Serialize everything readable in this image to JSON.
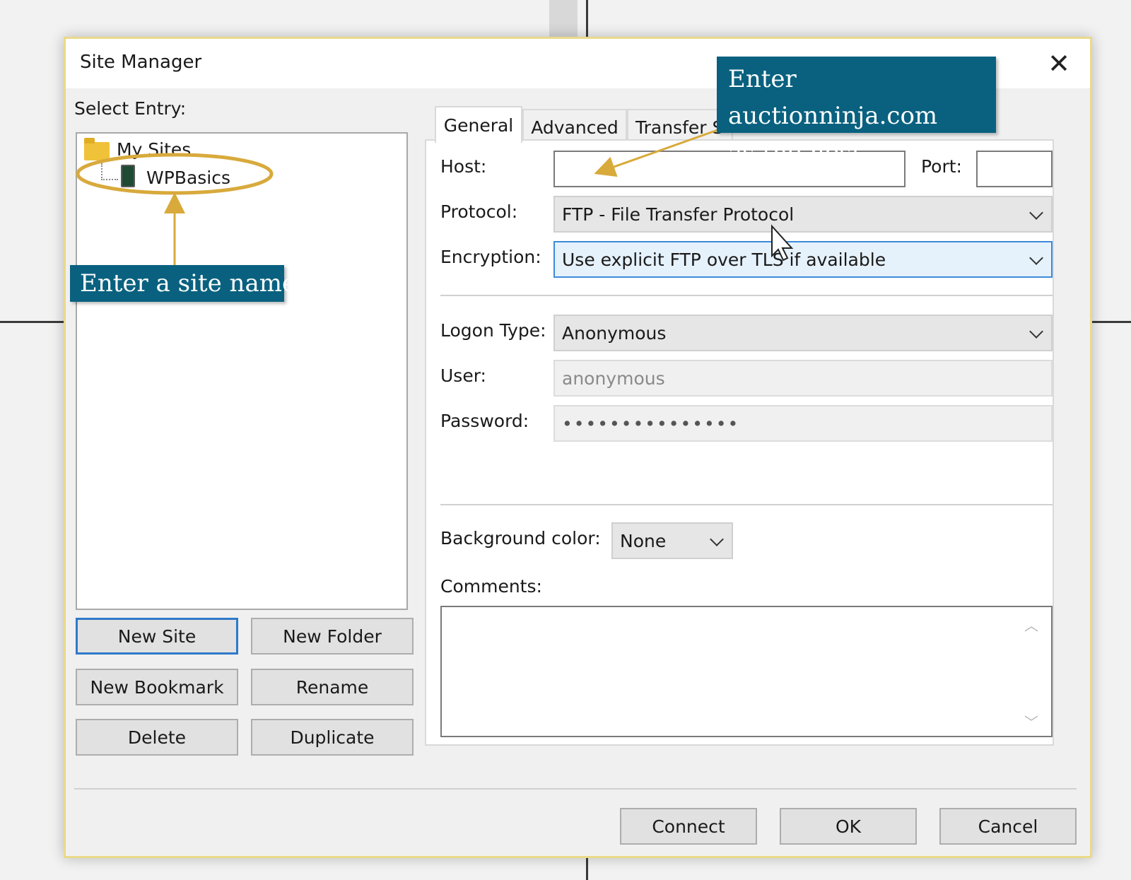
{
  "dialog": {
    "title": "Site Manager",
    "select_entry_label": "Select Entry:",
    "close_glyph": "✕"
  },
  "tree": {
    "root_label": "My Sites",
    "site_label": "WPBasics"
  },
  "left_buttons": {
    "new_site": "New Site",
    "new_folder": "New Folder",
    "new_bookmark": "New Bookmark",
    "rename": "Rename",
    "delete": "Delete",
    "duplicate": "Duplicate"
  },
  "tabs": [
    "General",
    "Advanced",
    "Transfer S"
  ],
  "general": {
    "host_label": "Host:",
    "host_value": "",
    "port_label": "Port:",
    "port_value": "",
    "protocol_label": "Protocol:",
    "protocol_value": "FTP - File Transfer Protocol",
    "encryption_label": "Encryption:",
    "encryption_value": "Use explicit FTP over TLS if available",
    "logon_type_label": "Logon Type:",
    "logon_type_value": "Anonymous",
    "user_label": "User:",
    "user_value": "anonymous",
    "password_label": "Password:",
    "password_value": "•••••••••••••••",
    "bg_color_label": "Background color:",
    "bg_color_value": "None",
    "comments_label": "Comments:"
  },
  "bottom_buttons": {
    "connect": "Connect",
    "ok": "OK",
    "cancel": "Cancel"
  },
  "annotations": {
    "host_callout_line1": "Enter auctionninja.com",
    "host_callout_line2": "as the host.",
    "site_callout": "Enter a site name."
  },
  "colors": {
    "callout_bg": "#09617f",
    "highlight_ring": "#d8aa3c",
    "focus_blue": "#2f79c9"
  }
}
